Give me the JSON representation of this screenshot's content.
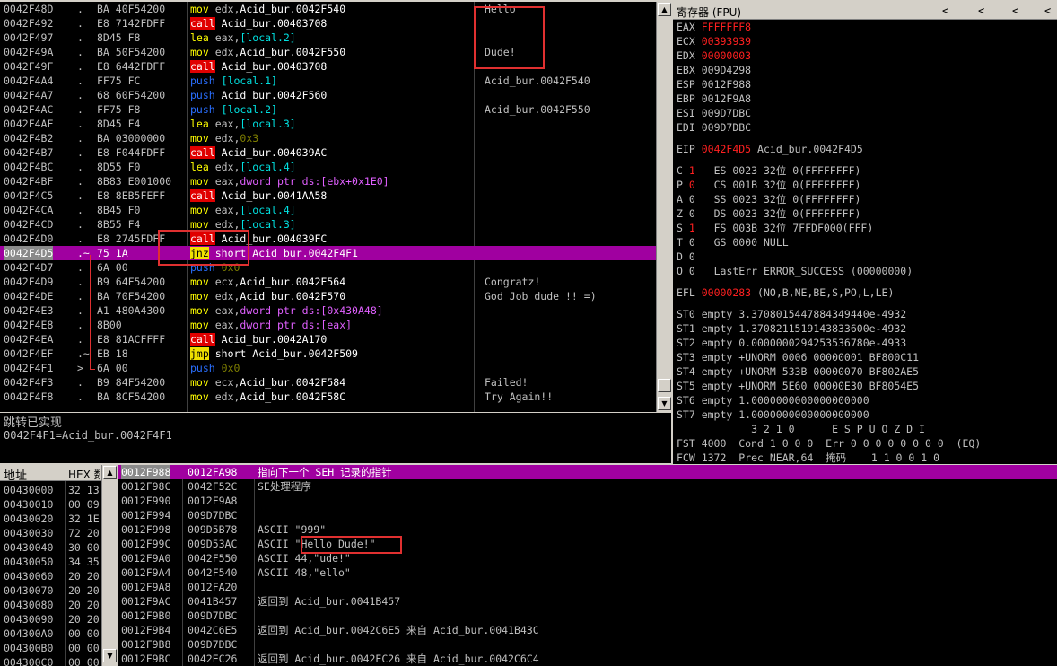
{
  "disasm": {
    "rows": [
      {
        "addr": "0042F48D",
        "mark": ".",
        "hex": "BA 40F54200",
        "op": "mov",
        "opc": "mov",
        "args": [
          [
            "edx,",
            ""
          ],
          [
            "Acid_bur.0042F540",
            "w"
          ]
        ],
        "com": "Hello"
      },
      {
        "addr": "0042F492",
        "mark": ".",
        "hex": "E8 7142FDFF",
        "op": "call",
        "opc": "call",
        "args": [
          [
            "Acid_bur.00403708",
            "w"
          ]
        ],
        "com": ""
      },
      {
        "addr": "0042F497",
        "mark": ".",
        "hex": "8D45 F8",
        "op": "lea",
        "opc": "lea",
        "args": [
          [
            "eax,",
            ""
          ],
          [
            "[local.2]",
            "c"
          ]
        ],
        "com": ""
      },
      {
        "addr": "0042F49A",
        "mark": ".",
        "hex": "BA 50F54200",
        "op": "mov",
        "opc": "mov",
        "args": [
          [
            "edx,",
            ""
          ],
          [
            "Acid_bur.0042F550",
            "w"
          ]
        ],
        "com": "Dude!"
      },
      {
        "addr": "0042F49F",
        "mark": ".",
        "hex": "E8 6442FDFF",
        "op": "call",
        "opc": "call",
        "args": [
          [
            "Acid_bur.00403708",
            "w"
          ]
        ],
        "com": ""
      },
      {
        "addr": "0042F4A4",
        "mark": ".",
        "hex": "FF75 FC",
        "op": "push",
        "opc": "push",
        "args": [
          [
            "[local.1]",
            "c"
          ]
        ],
        "com": "Acid_bur.0042F540"
      },
      {
        "addr": "0042F4A7",
        "mark": ".",
        "hex": "68 60F54200",
        "op": "push",
        "opc": "push",
        "args": [
          [
            "Acid_bur.0042F560",
            "w"
          ]
        ],
        "com": ""
      },
      {
        "addr": "0042F4AC",
        "mark": ".",
        "hex": "FF75 F8",
        "op": "push",
        "opc": "push",
        "args": [
          [
            "[local.2]",
            "c"
          ]
        ],
        "com": "Acid_bur.0042F550"
      },
      {
        "addr": "0042F4AF",
        "mark": ".",
        "hex": "8D45 F4",
        "op": "lea",
        "opc": "lea",
        "args": [
          [
            "eax,",
            ""
          ],
          [
            "[local.3]",
            "c"
          ]
        ],
        "com": ""
      },
      {
        "addr": "0042F4B2",
        "mark": ".",
        "hex": "BA 03000000",
        "op": "mov",
        "opc": "mov",
        "args": [
          [
            "edx,",
            ""
          ],
          [
            "0x3",
            "g"
          ]
        ],
        "com": ""
      },
      {
        "addr": "0042F4B7",
        "mark": ".",
        "hex": "E8 F044FDFF",
        "op": "call",
        "opc": "call",
        "args": [
          [
            "Acid_bur.004039AC",
            "w"
          ]
        ],
        "com": ""
      },
      {
        "addr": "0042F4BC",
        "mark": ".",
        "hex": "8D55 F0",
        "op": "lea",
        "opc": "lea",
        "args": [
          [
            "edx,",
            ""
          ],
          [
            "[local.4]",
            "c"
          ]
        ],
        "com": ""
      },
      {
        "addr": "0042F4BF",
        "mark": ".",
        "hex": "8B83 E001000",
        "op": "mov",
        "opc": "mov",
        "args": [
          [
            "eax,",
            ""
          ],
          [
            "dword ptr ds:[ebx+0x1E0]",
            "m"
          ]
        ],
        "com": ""
      },
      {
        "addr": "0042F4C5",
        "mark": ".",
        "hex": "E8 8EB5FEFF",
        "op": "call",
        "opc": "call",
        "args": [
          [
            "Acid_bur.0041AA58",
            "w"
          ]
        ],
        "com": ""
      },
      {
        "addr": "0042F4CA",
        "mark": ".",
        "hex": "8B45 F0",
        "op": "mov",
        "opc": "mov",
        "args": [
          [
            "eax,",
            ""
          ],
          [
            "[local.4]",
            "c"
          ]
        ],
        "com": ""
      },
      {
        "addr": "0042F4CD",
        "mark": ".",
        "hex": "8B55 F4",
        "op": "mov",
        "opc": "mov",
        "args": [
          [
            "edx,",
            ""
          ],
          [
            "[local.3]",
            "c"
          ]
        ],
        "com": ""
      },
      {
        "addr": "0042F4D0",
        "mark": ".",
        "hex": "E8 2745FDFF",
        "op": "call",
        "opc": "call",
        "args": [
          [
            "Acid_bur.004039FC",
            "w"
          ]
        ],
        "com": ""
      },
      {
        "addr": "0042F4D5",
        "mark": ".~",
        "hex": "75 1A",
        "op": "jnz",
        "opc": "jmp",
        "args": [
          [
            "short Acid_bur.0042F4F1",
            "w"
          ]
        ],
        "com": "",
        "sel": true
      },
      {
        "addr": "0042F4D7",
        "mark": ".",
        "hex": "6A 00",
        "op": "push",
        "opc": "push",
        "args": [
          [
            "0x0",
            "g"
          ]
        ],
        "com": ""
      },
      {
        "addr": "0042F4D9",
        "mark": ".",
        "hex": "B9 64F54200",
        "op": "mov",
        "opc": "mov",
        "args": [
          [
            "ecx,",
            ""
          ],
          [
            "Acid_bur.0042F564",
            "w"
          ]
        ],
        "com": "Congratz!"
      },
      {
        "addr": "0042F4DE",
        "mark": ".",
        "hex": "BA 70F54200",
        "op": "mov",
        "opc": "mov",
        "args": [
          [
            "edx,",
            ""
          ],
          [
            "Acid_bur.0042F570",
            "w"
          ]
        ],
        "com": "God Job dude !! =)"
      },
      {
        "addr": "0042F4E3",
        "mark": ".",
        "hex": "A1 480A4300",
        "op": "mov",
        "opc": "mov",
        "args": [
          [
            "eax,",
            ""
          ],
          [
            "dword ptr ds:[0x430A48]",
            "m"
          ]
        ],
        "com": ""
      },
      {
        "addr": "0042F4E8",
        "mark": ".",
        "hex": "8B00",
        "op": "mov",
        "opc": "mov",
        "args": [
          [
            "eax,",
            ""
          ],
          [
            "dword ptr ds:[eax]",
            "m"
          ]
        ],
        "com": ""
      },
      {
        "addr": "0042F4EA",
        "mark": ".",
        "hex": "E8 81ACFFFF",
        "op": "call",
        "opc": "call",
        "args": [
          [
            "Acid_bur.0042A170",
            "w"
          ]
        ],
        "com": ""
      },
      {
        "addr": "0042F4EF",
        "mark": ".~",
        "hex": "EB 18",
        "op": "jmp",
        "opc": "jmp",
        "args": [
          [
            "short Acid_bur.0042F509",
            "w"
          ]
        ],
        "com": ""
      },
      {
        "addr": "0042F4F1",
        "mark": ">",
        "hex": "6A 00",
        "op": "push",
        "opc": "push",
        "args": [
          [
            "0x0",
            "g"
          ]
        ],
        "com": ""
      },
      {
        "addr": "0042F4F3",
        "mark": ".",
        "hex": "B9 84F54200",
        "op": "mov",
        "opc": "mov",
        "args": [
          [
            "ecx,",
            ""
          ],
          [
            "Acid_bur.0042F584",
            "w"
          ]
        ],
        "com": "Failed!"
      },
      {
        "addr": "0042F4F8",
        "mark": ".",
        "hex": "BA 8CF54200",
        "op": "mov",
        "opc": "mov",
        "args": [
          [
            "edx,",
            ""
          ],
          [
            "Acid_bur.0042F58C",
            "w"
          ]
        ],
        "com": "Try Again!!"
      }
    ]
  },
  "info": {
    "line1": "跳转已实现",
    "line2": "0042F4F1=Acid_bur.0042F4F1"
  },
  "registers": {
    "title": "寄存器 (FPU)",
    "nav": [
      "<",
      "<",
      "<",
      "<"
    ],
    "gp": [
      {
        "n": "EAX",
        "v": "FFFFFFF8",
        "red": true,
        "x": ""
      },
      {
        "n": "ECX",
        "v": "00393939",
        "red": true,
        "x": ""
      },
      {
        "n": "EDX",
        "v": "00000003",
        "red": true,
        "x": ""
      },
      {
        "n": "EBX",
        "v": "009D4298",
        "red": false,
        "x": ""
      },
      {
        "n": "ESP",
        "v": "0012F988",
        "red": false,
        "x": ""
      },
      {
        "n": "EBP",
        "v": "0012F9A8",
        "red": false,
        "x": ""
      },
      {
        "n": "ESI",
        "v": "009D7DBC",
        "red": false,
        "x": ""
      },
      {
        "n": "EDI",
        "v": "009D7DBC",
        "red": false,
        "x": ""
      }
    ],
    "eip": {
      "n": "EIP",
      "v": "0042F4D5",
      "x": "Acid_bur.0042F4D5"
    },
    "flags": [
      {
        "f": "C",
        "b": "1",
        "red": true,
        "seg": "ES 0023 32位 0(FFFFFFFF)"
      },
      {
        "f": "P",
        "b": "0",
        "red": true,
        "seg": "CS 001B 32位 0(FFFFFFFF)"
      },
      {
        "f": "A",
        "b": "0",
        "red": false,
        "seg": "SS 0023 32位 0(FFFFFFFF)"
      },
      {
        "f": "Z",
        "b": "0",
        "red": false,
        "seg": "DS 0023 32位 0(FFFFFFFF)"
      },
      {
        "f": "S",
        "b": "1",
        "red": true,
        "seg": "FS 003B 32位 7FFDF000(FFF)"
      },
      {
        "f": "T",
        "b": "0",
        "red": false,
        "seg": "GS 0000 NULL"
      },
      {
        "f": "D",
        "b": "0",
        "red": false,
        "seg": ""
      },
      {
        "f": "O",
        "b": "0",
        "red": false,
        "seg": "LastErr ERROR_SUCCESS (00000000)"
      }
    ],
    "efl": {
      "n": "EFL",
      "v": "00000283",
      "x": "(NO,B,NE,BE,S,PO,L,LE)"
    },
    "fpu": [
      "ST0 empty 3.3708015447884349440e-4932",
      "ST1 empty 1.3708211519143833600e-4932",
      "ST2 empty 0.0000000294253536780e-4933",
      "ST3 empty +UNORM 0006 00000001 BF800C11",
      "ST4 empty +UNORM 533B 00000070 BF802AE5",
      "ST5 empty +UNORM 5E60 00000E30 BF8054E5",
      "ST6 empty 1.0000000000000000000",
      "ST7 empty 1.0000000000000000000",
      "            3 2 1 0      E S P U O Z D I",
      "FST 4000  Cond 1 0 0 0  Err 0 0 0 0 0 0 0 0  (EQ)",
      "FCW 1372  Prec NEAR,64  掩码    1 1 0 0 1 0"
    ]
  },
  "dump": {
    "hdr_addr": "地址",
    "hdr_hex": "HEX 数",
    "rows": [
      {
        "a": "00430000",
        "h": "32 13"
      },
      {
        "a": "00430010",
        "h": "00 09"
      },
      {
        "a": "00430020",
        "h": "32 1E"
      },
      {
        "a": "00430030",
        "h": "72 20"
      },
      {
        "a": "00430040",
        "h": "30 00"
      },
      {
        "a": "00430050",
        "h": "34 35"
      },
      {
        "a": "00430060",
        "h": "20 20"
      },
      {
        "a": "00430070",
        "h": "20 20"
      },
      {
        "a": "00430080",
        "h": "20 20"
      },
      {
        "a": "00430090",
        "h": "20 20"
      },
      {
        "a": "004300A0",
        "h": "00 00"
      },
      {
        "a": "004300B0",
        "h": "00 00"
      },
      {
        "a": "004300C0",
        "h": "00 00"
      }
    ]
  },
  "stack": {
    "rows": [
      {
        "a": "0012F988",
        "v": "0012FA98",
        "c": "指向下一个 SEH 记录的指针",
        "sel": true
      },
      {
        "a": "0012F98C",
        "v": "0042F52C",
        "c": "SE处理程序"
      },
      {
        "a": "0012F990",
        "v": "0012F9A8",
        "c": ""
      },
      {
        "a": "0012F994",
        "v": "009D7DBC",
        "c": ""
      },
      {
        "a": "0012F998",
        "v": "009D5B78",
        "c": "ASCII \"999\""
      },
      {
        "a": "0012F99C",
        "v": "009D53AC",
        "c": "ASCII \"Hello Dude!\""
      },
      {
        "a": "0012F9A0",
        "v": "0042F550",
        "c": "ASCII 44,\"ude!\""
      },
      {
        "a": "0012F9A4",
        "v": "0042F540",
        "c": "ASCII 48,\"ello\""
      },
      {
        "a": "0012F9A8",
        "v": "0012FA20",
        "c": ""
      },
      {
        "a": "0012F9AC",
        "v": "0041B457",
        "c": "返回到 Acid_bur.0041B457"
      },
      {
        "a": "0012F9B0",
        "v": "009D7DBC",
        "c": ""
      },
      {
        "a": "0012F9B4",
        "v": "0042C6E5",
        "c": "返回到 Acid_bur.0042C6E5 来自 Acid_bur.0041B43C"
      },
      {
        "a": "0012F9B8",
        "v": "009D7DBC",
        "c": ""
      },
      {
        "a": "0012F9BC",
        "v": "0042EC26",
        "c": "返回到 Acid_bur.0042EC26 来自 Acid_bur.0042C6C4"
      }
    ]
  },
  "colors": {
    "selected": "#a000a0",
    "call": "#e00000",
    "jmp": "#f0e000",
    "push": "#2a6fff",
    "highlight": "#e03030"
  }
}
